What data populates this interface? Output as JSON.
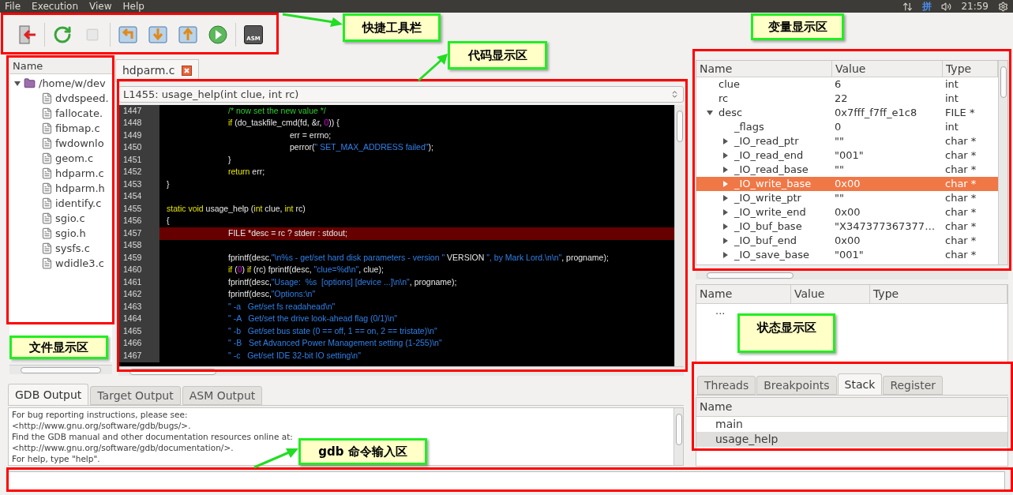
{
  "menu": [
    {
      "label": "File"
    },
    {
      "label": "Execution"
    },
    {
      "label": "View"
    },
    {
      "label": "Help"
    }
  ],
  "tray": {
    "input_method": "拼",
    "clock": "21:59"
  },
  "toolbar": {
    "groups": [
      [
        {
          "kind": "exit",
          "disabled": false
        }
      ],
      [
        {
          "kind": "reload",
          "disabled": false
        },
        {
          "kind": "stop",
          "disabled": true
        }
      ],
      [
        {
          "kind": "step_into",
          "disabled": false
        },
        {
          "kind": "step_over",
          "disabled": false
        },
        {
          "kind": "step_out",
          "disabled": false
        },
        {
          "kind": "continue",
          "disabled": false
        }
      ],
      [
        {
          "kind": "asm",
          "label": "ASM",
          "disabled": false
        }
      ]
    ]
  },
  "file_tree": {
    "header": "Name",
    "root": {
      "name": "/home/w/dev",
      "expanded": true,
      "children": [
        {
          "name": "dvdspeed."
        },
        {
          "name": "fallocate."
        },
        {
          "name": "fibmap.c"
        },
        {
          "name": "fwdownlo"
        },
        {
          "name": "geom.c"
        },
        {
          "name": "hdparm.c"
        },
        {
          "name": "hdparm.h"
        },
        {
          "name": "identify.c"
        },
        {
          "name": "sgio.c"
        },
        {
          "name": "sgio.h"
        },
        {
          "name": "sysfs.c"
        },
        {
          "name": "wdidle3.c"
        }
      ]
    }
  },
  "editor": {
    "tabs": [
      {
        "label": "hdparm.c",
        "selected": true
      }
    ],
    "function_selector": "L1455: usage_help(int clue, int rc)",
    "lines": [
      {
        "number": "1447",
        "highlighted": false,
        "segments": [
          {
            "text": "\t/* now set the new value */",
            "kind": "comment"
          }
        ]
      },
      {
        "number": "1448",
        "highlighted": false,
        "segments": [
          {
            "text": "\tif",
            "kind": "keyword"
          },
          {
            "text": " (do_taskfile_cmd(fd, &r, ",
            "kind": "plain"
          },
          {
            "text": "0",
            "kind": "number"
          },
          {
            "text": ")) {",
            "kind": "plain"
          }
        ]
      },
      {
        "number": "1449",
        "highlighted": false,
        "segments": [
          {
            "text": "\t\terr = errno;",
            "kind": "plain"
          }
        ]
      },
      {
        "number": "1450",
        "highlighted": false,
        "segments": [
          {
            "text": "\t\tperror(",
            "kind": "plain"
          },
          {
            "text": "\" SET_MAX_ADDRESS failed\"",
            "kind": "string"
          },
          {
            "text": ");",
            "kind": "plain"
          }
        ]
      },
      {
        "number": "1451",
        "highlighted": false,
        "segments": [
          {
            "text": "\t}",
            "kind": "plain"
          }
        ]
      },
      {
        "number": "1452",
        "highlighted": false,
        "segments": [
          {
            "text": "\treturn",
            "kind": "keyword"
          },
          {
            "text": " err;",
            "kind": "plain"
          }
        ]
      },
      {
        "number": "1453",
        "highlighted": false,
        "segments": [
          {
            "text": "}",
            "kind": "plain"
          }
        ]
      },
      {
        "number": "1454",
        "highlighted": false
      },
      {
        "number": "1455",
        "highlighted": false,
        "segments": [
          {
            "text": "static void",
            "kind": "keyword"
          },
          {
            "text": " usage_help (",
            "kind": "plain"
          },
          {
            "text": "int",
            "kind": "keyword"
          },
          {
            "text": " clue, ",
            "kind": "plain"
          },
          {
            "text": "int",
            "kind": "keyword"
          },
          {
            "text": " rc)",
            "kind": "plain"
          }
        ]
      },
      {
        "number": "1456",
        "highlighted": false,
        "segments": [
          {
            "text": "{",
            "kind": "plain"
          }
        ]
      },
      {
        "number": "1457",
        "highlighted": true,
        "segments": [
          {
            "text": "\tFILE *desc = rc ? stderr : stdout;",
            "kind": "plain"
          }
        ]
      },
      {
        "number": "1458",
        "highlighted": false
      },
      {
        "number": "1459",
        "highlighted": false,
        "segments": [
          {
            "text": "\tfprintf(desc,",
            "kind": "plain"
          },
          {
            "text": "\"\\n%s - get/set hard disk parameters - version \"",
            "kind": "string"
          },
          {
            "text": " VERSION ",
            "kind": "plain"
          },
          {
            "text": "\", by Mark Lord.\\n\\n\"",
            "kind": "string"
          },
          {
            "text": ", progname);",
            "kind": "plain"
          }
        ]
      },
      {
        "number": "1460",
        "highlighted": false,
        "segments": [
          {
            "text": "\tif",
            "kind": "keyword"
          },
          {
            "text": " (",
            "kind": "plain"
          },
          {
            "text": "0",
            "kind": "number"
          },
          {
            "text": ") ",
            "kind": "plain"
          },
          {
            "text": "if",
            "kind": "keyword"
          },
          {
            "text": " (rc) fprintf(desc, ",
            "kind": "plain"
          },
          {
            "text": "\"clue=%d\\n\"",
            "kind": "string"
          },
          {
            "text": ", clue);",
            "kind": "plain"
          }
        ]
      },
      {
        "number": "1461",
        "highlighted": false,
        "segments": [
          {
            "text": "\tfprintf(desc,",
            "kind": "plain"
          },
          {
            "text": "\"Usage:  %s  [options] [device ...]\\n\\n\"",
            "kind": "string"
          },
          {
            "text": ", progname);",
            "kind": "plain"
          }
        ]
      },
      {
        "number": "1462",
        "highlighted": false,
        "segments": [
          {
            "text": "\tfprintf(desc,",
            "kind": "plain"
          },
          {
            "text": "\"Options:\\n\"",
            "kind": "string"
          }
        ]
      },
      {
        "number": "1463",
        "highlighted": false,
        "segments": [
          {
            "text": "\t\" -a   Get/set fs readahead\\n\"",
            "kind": "string"
          }
        ]
      },
      {
        "number": "1464",
        "highlighted": false,
        "segments": [
          {
            "text": "\t\" -A   Get/set the drive look-ahead flag (0/1)\\n\"",
            "kind": "string"
          }
        ]
      },
      {
        "number": "1465",
        "highlighted": false,
        "segments": [
          {
            "text": "\t\" -b   Get/set bus state (0 == off, 1 == on, 2 == tristate)\\n\"",
            "kind": "string"
          }
        ]
      },
      {
        "number": "1466",
        "highlighted": false,
        "segments": [
          {
            "text": "\t\" -B   Set Advanced Power Management setting (1-255)\\n\"",
            "kind": "string"
          }
        ]
      },
      {
        "number": "1467",
        "highlighted": false,
        "segments": [
          {
            "text": "\t\" -c   Get/set IDE 32-bit IO setting\\n\"",
            "kind": "string"
          }
        ]
      }
    ]
  },
  "output": {
    "tabs": [
      {
        "label": "GDB Output",
        "selected": true
      },
      {
        "label": "Target Output",
        "selected": false
      },
      {
        "label": "ASM Output",
        "selected": false
      }
    ],
    "lines": [
      "For bug reporting instructions, please see:",
      "<http://www.gnu.org/software/gdb/bugs/>.",
      "Find the GDB manual and other documentation resources online at:",
      "<http://www.gnu.org/software/gdb/documentation/>.",
      "For help, type \"help\"."
    ]
  },
  "variables": {
    "columns": [
      "Name",
      "Value",
      "Type"
    ],
    "rows": [
      {
        "name": "clue",
        "value": "6",
        "type": "int",
        "selected": false
      },
      {
        "name": "rc",
        "value": "22",
        "type": "int",
        "selected": false
      },
      {
        "name": "desc",
        "value": "0x7fff_f7ff_e1c8",
        "type": "FILE *",
        "selected": false,
        "expanded": true,
        "children": [
          {
            "name": "_flags",
            "value": "0",
            "type": "int",
            "selected": false
          },
          {
            "name": "_IO_read_ptr",
            "value": "\"\"",
            "type": "char *",
            "selected": false,
            "expanded": false
          },
          {
            "name": "_IO_read_end",
            "value": "\"001\"",
            "type": "char *",
            "selected": false,
            "expanded": false
          },
          {
            "name": "_IO_read_base",
            "value": "\"\"",
            "type": "char *",
            "selected": false,
            "expanded": false
          },
          {
            "name": "_IO_write_base",
            "value": "0x00",
            "type": "char *",
            "selected": true,
            "expanded": false
          },
          {
            "name": "_IO_write_ptr",
            "value": "\"\"",
            "type": "char *",
            "selected": false,
            "expanded": false
          },
          {
            "name": "_IO_write_end",
            "value": "0x00",
            "type": "char *",
            "selected": false,
            "expanded": false
          },
          {
            "name": "_IO_buf_base",
            "value": "\"X347377367377…",
            "type": "char *",
            "selected": false,
            "expanded": false
          },
          {
            "name": "_IO_buf_end",
            "value": "0x00",
            "type": "char *",
            "selected": false,
            "expanded": false
          },
          {
            "name": "_IO_save_base",
            "value": "\"001\"",
            "type": "char *",
            "selected": false,
            "expanded": false
          }
        ]
      }
    ]
  },
  "status": {
    "columns": [
      "Name",
      "Value",
      "Type"
    ],
    "rows": [
      {
        "name": "..."
      }
    ]
  },
  "debug_tabs": {
    "tabs": [
      {
        "label": "Threads",
        "selected": false
      },
      {
        "label": "Breakpoints",
        "selected": false
      },
      {
        "label": "Stack",
        "selected": true
      },
      {
        "label": "Register",
        "selected": false
      }
    ],
    "header": "Name",
    "rows": [
      {
        "name": "main",
        "selected": false
      },
      {
        "name": "usage_help",
        "selected": true
      }
    ]
  },
  "annotations": [
    {
      "text": "快捷工具栏"
    },
    {
      "text": "变量显示区"
    },
    {
      "text": "代码显示区"
    },
    {
      "text": "状态显示区"
    },
    {
      "text": "文件显示区"
    },
    {
      "text": "gdb 命令输入区"
    }
  ]
}
